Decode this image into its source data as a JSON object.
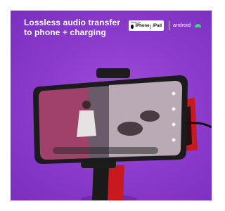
{
  "headline": "Lossless audio transfer to phone + charging",
  "badges": {
    "mfi_top": "Made for",
    "mfi_iphone": "iPhone",
    "mfi_ipad": "iPad",
    "android": "android"
  },
  "colors": {
    "background": "#8e3dce",
    "android_green": "#3ddc84",
    "mount_red": "#c8191e"
  }
}
